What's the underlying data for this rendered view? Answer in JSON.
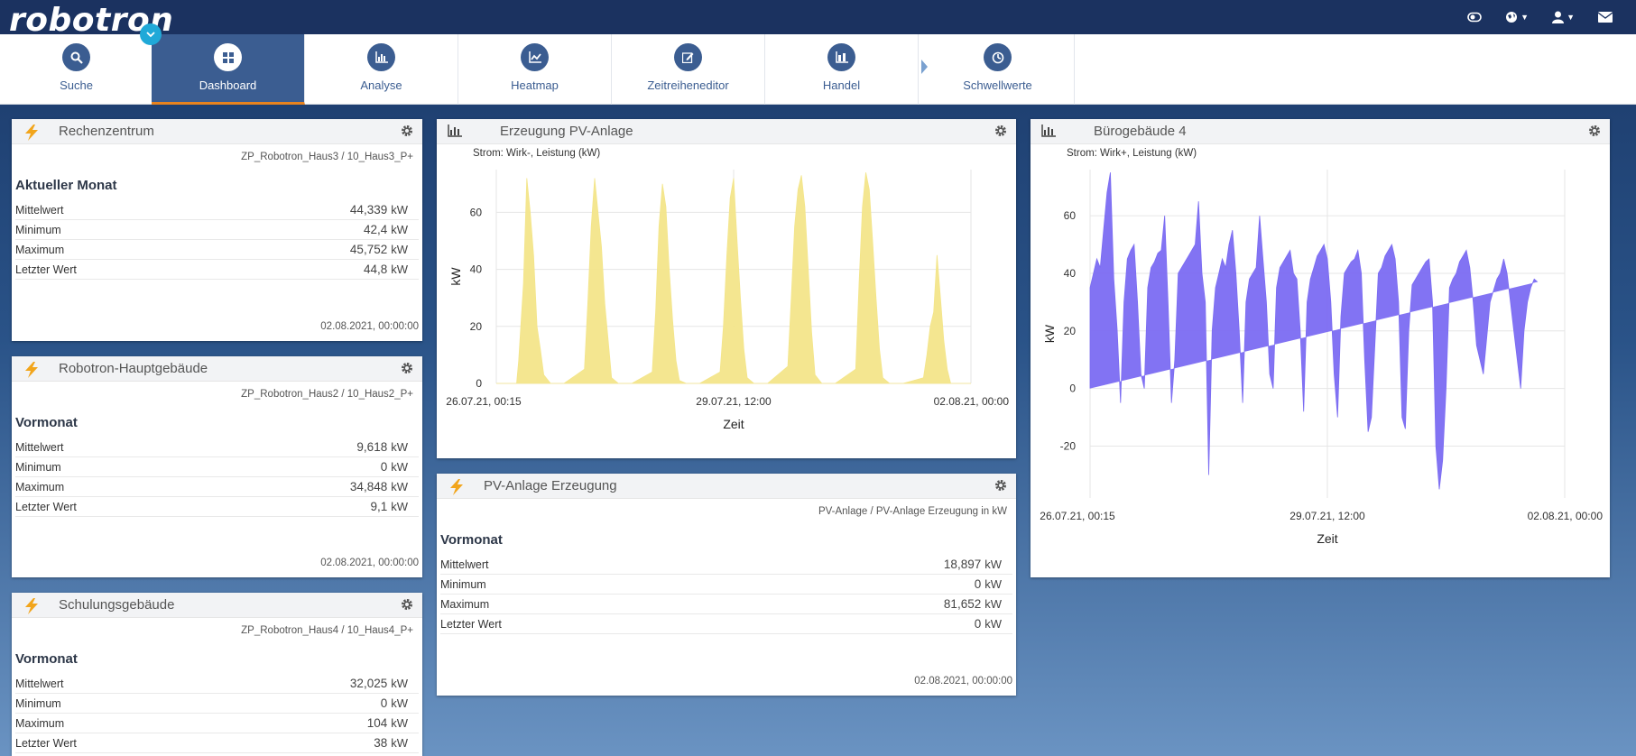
{
  "app": {
    "logo": "robotron",
    "logo_mark": "®"
  },
  "nav": {
    "items": [
      {
        "label": "Suche",
        "icon": "search-icon"
      },
      {
        "label": "Dashboard",
        "icon": "dashboard-icon"
      },
      {
        "label": "Analyse",
        "icon": "analysis-chart-icon"
      },
      {
        "label": "Heatmap",
        "icon": "heatmap-icon"
      },
      {
        "label": "Zeitreiheneditor",
        "icon": "edit-icon"
      },
      {
        "label": "Handel",
        "icon": "trade-icon"
      },
      {
        "label": "Schwellwerte",
        "icon": "threshold-icon"
      }
    ],
    "active_index": 1
  },
  "colors": {
    "accent": "#3b5d91",
    "active_underline": "#e8831f",
    "pv_fill": "#f3e58a",
    "buero_fill": "#7b6cf2",
    "lightning": "#f2a51c"
  },
  "kpi_widgets": [
    {
      "title": "Rechenzentrum",
      "source": "ZP_Robotron_Haus3 / 10_Haus3_P+",
      "period": "Aktueller Monat",
      "rows": [
        {
          "label": "Mittelwert",
          "value": "44,339",
          "unit": "kW"
        },
        {
          "label": "Minimum",
          "value": "42,4",
          "unit": "kW"
        },
        {
          "label": "Maximum",
          "value": "45,752",
          "unit": "kW"
        },
        {
          "label": "Letzter Wert",
          "value": "44,8",
          "unit": "kW"
        }
      ],
      "date": "02.08.2021, 00:00:00"
    },
    {
      "title": "Robotron-Hauptgebäude",
      "source": "ZP_Robotron_Haus2 / 10_Haus2_P+",
      "period": "Vormonat",
      "rows": [
        {
          "label": "Mittelwert",
          "value": "9,618",
          "unit": "kW"
        },
        {
          "label": "Minimum",
          "value": "0",
          "unit": "kW"
        },
        {
          "label": "Maximum",
          "value": "34,848",
          "unit": "kW"
        },
        {
          "label": "Letzter Wert",
          "value": "9,1",
          "unit": "kW"
        }
      ],
      "date": "02.08.2021, 00:00:00"
    },
    {
      "title": "Schulungsgebäude",
      "source": "ZP_Robotron_Haus4 / 10_Haus4_P+",
      "period": "Vormonat",
      "rows": [
        {
          "label": "Mittelwert",
          "value": "32,025",
          "unit": "kW"
        },
        {
          "label": "Minimum",
          "value": "0",
          "unit": "kW"
        },
        {
          "label": "Maximum",
          "value": "104",
          "unit": "kW"
        },
        {
          "label": "Letzter Wert",
          "value": "38",
          "unit": "kW"
        }
      ],
      "date": ""
    },
    {
      "title": "PV-Anlage Erzeugung",
      "source": "PV-Anlage / PV-Anlage Erzeugung in kW",
      "period": "Vormonat",
      "rows": [
        {
          "label": "Mittelwert",
          "value": "18,897",
          "unit": "kW"
        },
        {
          "label": "Minimum",
          "value": "0",
          "unit": "kW"
        },
        {
          "label": "Maximum",
          "value": "81,652",
          "unit": "kW"
        },
        {
          "label": "Letzter Wert",
          "value": "0",
          "unit": "kW"
        }
      ],
      "date": "02.08.2021, 00:00:00"
    }
  ],
  "chart_widgets": [
    {
      "title": "Erzeugung PV-Anlage",
      "subtitle": "Strom: Wirk-, Leistung (kW)"
    },
    {
      "title": "Bürogebäude 4",
      "subtitle": "Strom: Wirk+, Leistung (kW)"
    }
  ],
  "chart_data": [
    {
      "type": "area",
      "title": "Erzeugung PV-Anlage",
      "xlabel": "Zeit",
      "ylabel": "kW",
      "x_tick_labels": [
        "26.07.21, 00:15",
        "29.07.21, 12:00",
        "02.08.21, 00:00"
      ],
      "y_ticks": [
        0,
        20,
        40,
        60
      ],
      "ylim": [
        0,
        75
      ],
      "xlim_days": [
        0,
        7
      ],
      "grid": true,
      "color": "#f3e58a",
      "series": [
        {
          "x_days": [
            0.0,
            0.3,
            0.33,
            0.4,
            0.45,
            0.5,
            0.55,
            0.6,
            0.65,
            0.7,
            0.8,
            1.0,
            1.3,
            1.35,
            1.4,
            1.45,
            1.5,
            1.55,
            1.6,
            1.65,
            1.7,
            1.8,
            2.0,
            2.3,
            2.35,
            2.4,
            2.45,
            2.5,
            2.55,
            2.6,
            2.65,
            2.7,
            2.8,
            3.0,
            3.3,
            3.35,
            3.4,
            3.45,
            3.5,
            3.55,
            3.6,
            3.65,
            3.7,
            3.8,
            4.0,
            4.3,
            4.35,
            4.4,
            4.45,
            4.5,
            4.55,
            4.6,
            4.65,
            4.7,
            4.8,
            5.0,
            5.3,
            5.35,
            5.4,
            5.45,
            5.5,
            5.55,
            5.6,
            5.65,
            5.7,
            5.8,
            6.0,
            6.3,
            6.35,
            6.4,
            6.45,
            6.5,
            6.55,
            6.6,
            6.65,
            6.7,
            6.8,
            7.0
          ],
          "y": [
            0,
            0,
            8,
            35,
            72,
            60,
            45,
            20,
            12,
            3,
            0,
            0,
            5,
            28,
            55,
            72,
            60,
            48,
            28,
            15,
            2,
            0,
            0,
            4,
            25,
            55,
            70,
            62,
            40,
            22,
            8,
            1,
            0,
            0,
            4,
            20,
            45,
            65,
            72,
            50,
            30,
            12,
            2,
            0,
            0,
            6,
            30,
            55,
            68,
            73,
            62,
            40,
            18,
            3,
            0,
            0,
            5,
            35,
            62,
            74,
            68,
            50,
            30,
            12,
            2,
            0,
            0,
            2,
            10,
            20,
            25,
            45,
            30,
            15,
            5,
            0,
            0,
            0
          ]
        }
      ]
    },
    {
      "type": "area",
      "title": "Bürogebäude 4",
      "xlabel": "Zeit",
      "ylabel": "kW",
      "x_tick_labels": [
        "26.07.21, 00:15",
        "29.07.21, 12:00",
        "02.08.21, 00:00"
      ],
      "y_ticks": [
        -20,
        0,
        20,
        40,
        60
      ],
      "ylim": [
        -38,
        76
      ],
      "xlim_days": [
        0,
        7
      ],
      "grid": true,
      "color": "#7b6cf2",
      "series": [
        {
          "x_days": [
            0.0,
            0.05,
            0.1,
            0.15,
            0.2,
            0.25,
            0.3,
            0.35,
            0.4,
            0.45,
            0.5,
            0.55,
            0.6,
            0.65,
            0.7,
            0.75,
            0.8,
            0.85,
            0.9,
            0.95,
            1.0,
            1.05,
            1.1,
            1.15,
            1.2,
            1.25,
            1.3,
            1.35,
            1.4,
            1.45,
            1.5,
            1.55,
            1.6,
            1.65,
            1.7,
            1.75,
            1.8,
            1.85,
            1.9,
            1.95,
            2.0,
            2.05,
            2.1,
            2.15,
            2.2,
            2.25,
            2.3,
            2.35,
            2.4,
            2.45,
            2.5,
            2.55,
            2.6,
            2.65,
            2.7,
            2.75,
            2.8,
            2.85,
            2.9,
            2.95,
            3.0,
            3.05,
            3.1,
            3.15,
            3.2,
            3.25,
            3.3,
            3.35,
            3.4,
            3.45,
            3.5,
            3.55,
            3.6,
            3.65,
            3.7,
            3.75,
            3.8,
            3.85,
            3.9,
            3.95,
            4.0,
            4.05,
            4.1,
            4.15,
            4.2,
            4.25,
            4.3,
            4.35,
            4.4,
            4.45,
            4.5,
            4.55,
            4.6,
            4.65,
            4.7,
            4.75,
            4.8,
            4.85,
            4.9,
            4.95,
            5.0,
            5.05,
            5.1,
            5.15,
            5.2,
            5.25,
            5.3,
            5.35,
            5.4,
            5.45,
            5.5,
            5.55,
            5.6,
            5.65,
            5.7,
            5.8,
            5.9,
            6.0,
            6.05,
            6.1,
            6.15,
            6.2,
            6.25,
            6.3,
            6.35,
            6.4,
            6.45,
            6.5,
            6.55,
            6.6,
            6.65,
            6.7,
            6.75,
            6.8,
            6.85,
            6.9,
            6.95,
            7.0
          ],
          "y": [
            35,
            40,
            45,
            42,
            55,
            68,
            75,
            38,
            20,
            -5,
            30,
            45,
            48,
            50,
            30,
            5,
            0,
            35,
            42,
            44,
            47,
            48,
            60,
            30,
            -5,
            10,
            40,
            42,
            44,
            46,
            48,
            50,
            65,
            40,
            30,
            -30,
            20,
            35,
            40,
            45,
            42,
            50,
            55,
            40,
            20,
            -5,
            30,
            38,
            40,
            42,
            60,
            45,
            30,
            5,
            0,
            35,
            42,
            44,
            46,
            48,
            40,
            38,
            20,
            -8,
            30,
            38,
            42,
            46,
            48,
            50,
            45,
            30,
            5,
            -10,
            25,
            40,
            42,
            44,
            45,
            48,
            40,
            10,
            -15,
            -10,
            15,
            40,
            42,
            46,
            48,
            50,
            45,
            30,
            -10,
            -14,
            20,
            36,
            38,
            40,
            42,
            44,
            45,
            30,
            -20,
            -35,
            -25,
            0,
            35,
            38,
            40,
            44,
            46,
            48,
            42,
            30,
            15,
            5,
            30,
            38,
            40,
            45,
            40,
            30,
            20,
            10,
            0,
            20,
            30,
            35,
            38,
            37
          ]
        }
      ]
    }
  ]
}
